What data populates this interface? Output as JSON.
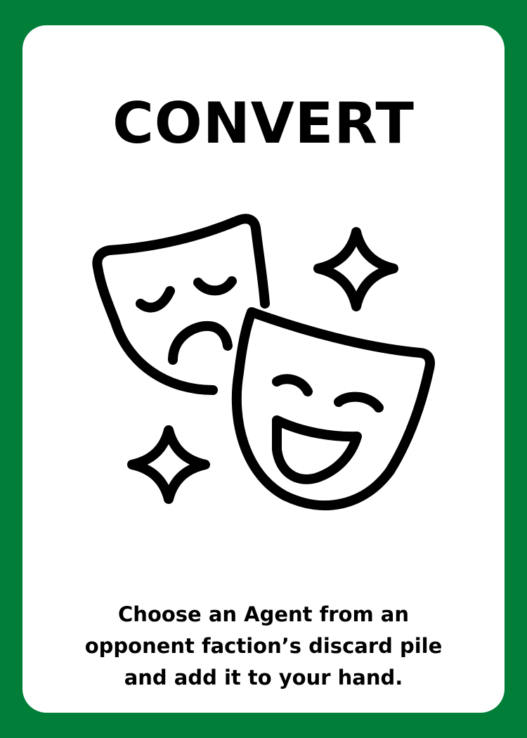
{
  "card": {
    "title": "CONVERT",
    "description_lines": [
      "Choose an Agent from an",
      "opponent faction’s discard pile",
      "and add it to your hand."
    ],
    "icon": "theater-masks-icon",
    "border_color": "#017f39",
    "face_color": "#ffffff"
  }
}
